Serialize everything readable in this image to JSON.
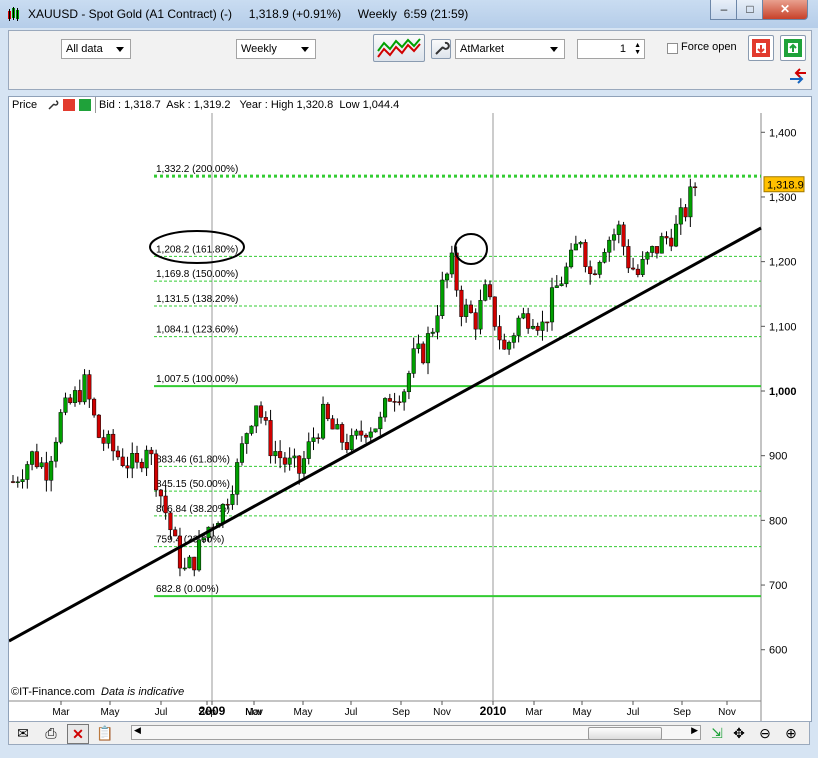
{
  "window": {
    "title": "XAUUSD - Spot Gold (A1 Contract) (-)     1,318.9 (+0.91%)     Weekly  6:59 (21:59)",
    "minimize": "–",
    "maximize": "□",
    "close": "✕"
  },
  "toolbar": {
    "data_range": "All data",
    "interval": "Weekly",
    "order_type": "AtMarket",
    "quantity": "1",
    "force_open_label": "Force open"
  },
  "chart": {
    "instrument_label": "Price",
    "quote_line": "Bid : 1,318.7  Ask : 1,319.2   Year : High 1,320.8  Low 1,044.4",
    "watermark": "©IT-Finance.com",
    "disclaimer": "Data is indicative",
    "last_price_tag": "1,318.9",
    "price_axis": [
      "1,400",
      "1,300",
      "1,200",
      "1,100",
      "1,000",
      "900",
      "800",
      "700",
      "600"
    ],
    "time_axis": [
      {
        "label": "Mar",
        "bold": false
      },
      {
        "label": "May",
        "bold": false
      },
      {
        "label": "Jul",
        "bold": false
      },
      {
        "label": "Sep",
        "bold": false
      },
      {
        "label": "Nov",
        "bold": false
      },
      {
        "label": "2009",
        "bold": true
      },
      {
        "label": "Mar",
        "bold": false
      },
      {
        "label": "May",
        "bold": false
      },
      {
        "label": "Jul",
        "bold": false
      },
      {
        "label": "Sep",
        "bold": false
      },
      {
        "label": "Nov",
        "bold": false
      },
      {
        "label": "2010",
        "bold": true
      },
      {
        "label": "Mar",
        "bold": false
      },
      {
        "label": "May",
        "bold": false
      },
      {
        "label": "Jul",
        "bold": false
      },
      {
        "label": "Sep",
        "bold": false
      },
      {
        "label": "Nov",
        "bold": false
      }
    ],
    "fib_levels": [
      {
        "label": "1,332.2 (200.00%)",
        "price": 1332.2,
        "style": "thick-dotted"
      },
      {
        "label": "1,208.2 (161.80%)",
        "price": 1208.2,
        "style": "dashed"
      },
      {
        "label": "1,169.8 (150.00%)",
        "price": 1169.8,
        "style": "dashed"
      },
      {
        "label": "1,131.5 (138.20%)",
        "price": 1131.5,
        "style": "dashed"
      },
      {
        "label": "1,084.1 (123.60%)",
        "price": 1084.1,
        "style": "dashed"
      },
      {
        "label": "1,007.5 (100.00%)",
        "price": 1007.5,
        "style": "solid"
      },
      {
        "label": "883.46 (61.80%)",
        "price": 883.46,
        "style": "dashed"
      },
      {
        "label": "845.15 (50.00%)",
        "price": 845.15,
        "style": "dashed"
      },
      {
        "label": "806.84 (38.20%)",
        "price": 806.84,
        "style": "dashed"
      },
      {
        "label": "759.4 (23.60%)",
        "price": 759.4,
        "style": "dashed"
      },
      {
        "label": "682.8 (0.00%)",
        "price": 682.8,
        "style": "solid"
      }
    ],
    "colors": {
      "bull": "#00a000",
      "bear": "#d00000",
      "fib": "#33cc33",
      "trendline": "#000000",
      "price_tag": "#ffc000"
    }
  },
  "chart_data": {
    "type": "candlestick",
    "title": "XAUUSD - Spot Gold (A1 Contract) (-)",
    "interval": "Weekly",
    "ylim": [
      550,
      1430
    ],
    "x_ticks": [
      "Mar",
      "May",
      "Jul",
      "Sep",
      "Nov",
      "2009",
      "Mar",
      "May",
      "Jul",
      "Sep",
      "Nov",
      "2010",
      "Mar",
      "May",
      "Jul",
      "Sep",
      "Nov"
    ],
    "close_path": [
      {
        "w": 0,
        "c": 860
      },
      {
        "w": 4,
        "c": 900
      },
      {
        "w": 7,
        "c": 880
      },
      {
        "w": 10,
        "c": 960
      },
      {
        "w": 13,
        "c": 990
      },
      {
        "w": 15,
        "c": 1010
      },
      {
        "w": 18,
        "c": 930
      },
      {
        "w": 22,
        "c": 900
      },
      {
        "w": 26,
        "c": 880
      },
      {
        "w": 28,
        "c": 920
      },
      {
        "w": 31,
        "c": 840
      },
      {
        "w": 34,
        "c": 760
      },
      {
        "w": 36,
        "c": 720
      },
      {
        "w": 38,
        "c": 740
      },
      {
        "w": 41,
        "c": 790
      },
      {
        "w": 44,
        "c": 820
      },
      {
        "w": 47,
        "c": 880
      },
      {
        "w": 49,
        "c": 940
      },
      {
        "w": 51,
        "c": 985
      },
      {
        "w": 54,
        "c": 915
      },
      {
        "w": 57,
        "c": 890
      },
      {
        "w": 60,
        "c": 875
      },
      {
        "w": 63,
        "c": 930
      },
      {
        "w": 65,
        "c": 960
      },
      {
        "w": 68,
        "c": 930
      },
      {
        "w": 71,
        "c": 915
      },
      {
        "w": 74,
        "c": 945
      },
      {
        "w": 77,
        "c": 950
      },
      {
        "w": 79,
        "c": 995
      },
      {
        "w": 82,
        "c": 1005
      },
      {
        "w": 84,
        "c": 1050
      },
      {
        "w": 86,
        "c": 1060
      },
      {
        "w": 88,
        "c": 1100
      },
      {
        "w": 90,
        "c": 1160
      },
      {
        "w": 92,
        "c": 1195
      },
      {
        "w": 94,
        "c": 1130
      },
      {
        "w": 97,
        "c": 1110
      },
      {
        "w": 99,
        "c": 1150
      },
      {
        "w": 101,
        "c": 1110
      },
      {
        "w": 103,
        "c": 1060
      },
      {
        "w": 106,
        "c": 1110
      },
      {
        "w": 109,
        "c": 1120
      },
      {
        "w": 111,
        "c": 1100
      },
      {
        "w": 114,
        "c": 1160
      },
      {
        "w": 117,
        "c": 1200
      },
      {
        "w": 119,
        "c": 1240
      },
      {
        "w": 121,
        "c": 1180
      },
      {
        "w": 124,
        "c": 1230
      },
      {
        "w": 127,
        "c": 1250
      },
      {
        "w": 129,
        "c": 1200
      },
      {
        "w": 131,
        "c": 1180
      },
      {
        "w": 133,
        "c": 1205
      },
      {
        "w": 136,
        "c": 1230
      },
      {
        "w": 139,
        "c": 1250
      },
      {
        "w": 141,
        "c": 1280
      },
      {
        "w": 143,
        "c": 1319
      }
    ]
  }
}
